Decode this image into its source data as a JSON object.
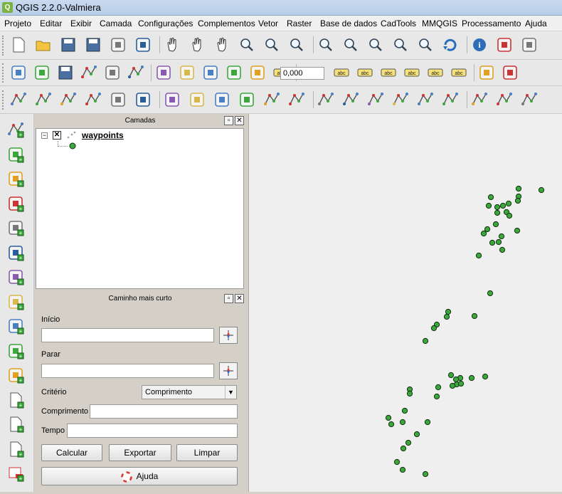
{
  "window": {
    "title": "QGIS 2.2.0-Valmiera"
  },
  "menubar": [
    "Projeto",
    "Editar",
    "Exibir",
    "Camada",
    "Configurações",
    "Complementos",
    "Vetor",
    "Raster",
    "Base de dados",
    "CadTools",
    "MMQGIS",
    "Processamento",
    "Ajuda"
  ],
  "toolbar1": [
    "new-project-icon",
    "open-project-icon",
    "save-project-icon",
    "save-as-icon",
    "new-print-composer-icon",
    "composer-manager-icon",
    "touch-icon",
    "pan-icon",
    "pan-to-selection-icon",
    "zoom-in-icon",
    "zoom-out-icon",
    "zoom-actual-size-icon",
    "zoom-full-icon",
    "zoom-to-selection-icon",
    "zoom-to-layer-icon",
    "zoom-last-icon",
    "zoom-next-icon",
    "refresh-icon",
    "identify-icon",
    "run-action-icon",
    "select-features-icon"
  ],
  "toolbar2": [
    "current-edits-icon",
    "toggle-editing-icon",
    "save-layer-edits-icon",
    "add-feature-icon",
    "move-feature-icon",
    "node-tool-icon",
    "delete-selected-icon",
    "cut-features-icon",
    "copy-features-icon",
    "paste-features-icon",
    "rotate-symbols-icon",
    "label-pin-icon",
    "label-show-hide-icon",
    "label-move-icon",
    "label-rotate-icon",
    "label-change-icon",
    "label-bg-icon",
    "label-icon",
    "measure-icon",
    "chart-icon"
  ],
  "toolbar2_scale": "0,000",
  "toolbar3": [
    "vector-layer-a-icon",
    "vector-layer-b-icon",
    "vector-layer-c-icon",
    "add-vector-layer-icon",
    "add-raster-layer-icon",
    "add-postgis-icon",
    "add-spatialite-icon",
    "add-mssql-icon",
    "add-oracle-icon",
    "add-wms-icon",
    "digitize-1-icon",
    "digitize-2-icon",
    "digitize-3-icon",
    "digitize-4-icon",
    "digitize-5-icon",
    "digitize-6-icon",
    "digitize-7-icon",
    "digitize-8-icon",
    "digitize-9-icon",
    "digitize-10-icon",
    "digitize-11-icon"
  ],
  "leftbar": [
    "add-vector-layer-icon",
    "add-raster-layer-icon",
    "add-postgis-layer-icon",
    "add-spatialite-layer-icon",
    "add-mssql-layer-icon",
    "add-oracle-layer-icon",
    "add-wms-layer-icon",
    "add-delimited-text-icon",
    "add-wcs-layer-icon",
    "add-wfs-layer-icon",
    "add-gps-layer-icon",
    "new-shapefile-icon",
    "new-spatialite-icon",
    "new-gpx-icon",
    "remove-layer-icon"
  ],
  "layers_panel": {
    "title": "Camadas",
    "layer_name": "waypoints"
  },
  "route_panel": {
    "title": "Caminho mais curto",
    "start_label": "Início",
    "stop_label": "Parar",
    "criterion_label": "Critério",
    "criterion_value": "Comprimento",
    "length_label": "Comprimento",
    "time_label": "Tempo",
    "calculate_button": "Calcular",
    "export_button": "Exportar",
    "clear_button": "Limpar",
    "help_button": "Ajuda"
  },
  "colors": {
    "point_fill": "#3aa83a",
    "point_stroke": "#0d2d0d",
    "map_bg": "#efefef"
  }
}
